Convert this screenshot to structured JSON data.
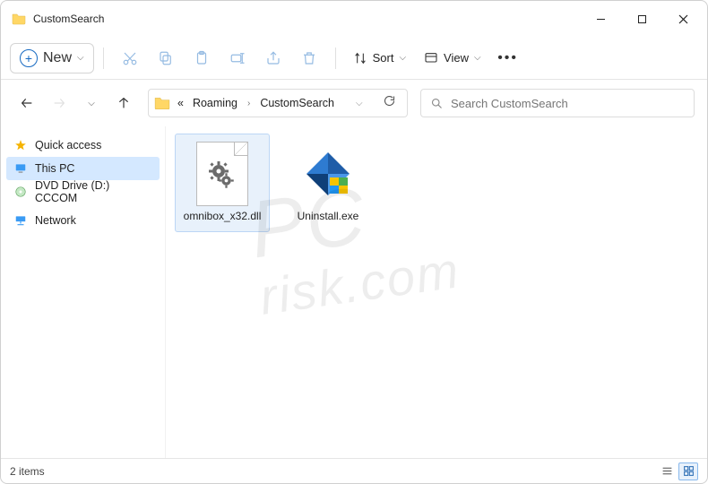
{
  "window": {
    "title": "CustomSearch"
  },
  "toolbar": {
    "new_label": "New",
    "sort_label": "Sort",
    "view_label": "View"
  },
  "breadcrumb": {
    "ellipsis": "«",
    "parent": "Roaming",
    "current": "CustomSearch"
  },
  "search": {
    "placeholder": "Search CustomSearch"
  },
  "sidebar": {
    "items": [
      {
        "label": "Quick access"
      },
      {
        "label": "This PC"
      },
      {
        "label": "DVD Drive (D:) CCCOM"
      },
      {
        "label": "Network"
      }
    ]
  },
  "files": [
    {
      "name": "omnibox_x32.dll",
      "type": "dll"
    },
    {
      "name": "Uninstall.exe",
      "type": "exe"
    }
  ],
  "status": {
    "count_text": "2 items"
  },
  "watermark": {
    "line1": "PC",
    "line2": "risk.com"
  }
}
